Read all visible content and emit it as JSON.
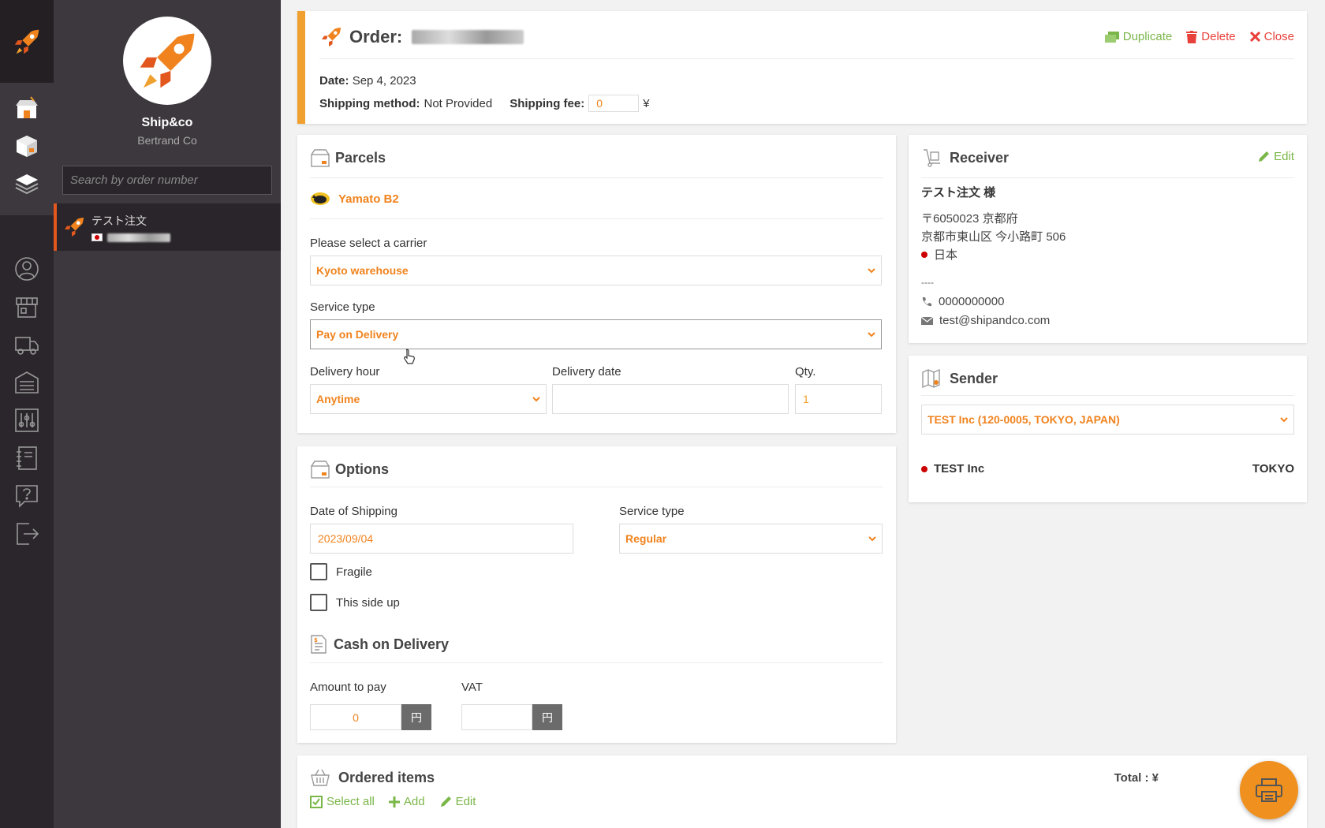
{
  "app": {
    "name": "Ship&co",
    "org": "Bertrand Co"
  },
  "sidebar": {
    "search_placeholder": "Search by order number",
    "order": {
      "name": "テスト注文"
    }
  },
  "order": {
    "title": "Order:",
    "actions": {
      "duplicate": "Duplicate",
      "delete": "Delete",
      "close": "Close"
    },
    "date_label": "Date:",
    "date_value": "Sep 4, 2023",
    "shipping_method_label": "Shipping method:",
    "shipping_method_value": "Not Provided",
    "shipping_fee_label": "Shipping fee:",
    "shipping_fee_value": "0",
    "currency_symbol": "¥"
  },
  "parcels": {
    "title": "Parcels",
    "carrier_name": "Yamato B2",
    "carrier_label": "Please select a carrier",
    "carrier_value": "Kyoto warehouse",
    "service_type_label": "Service type",
    "service_type_value": "Pay on Delivery",
    "delivery_hour_label": "Delivery hour",
    "delivery_hour_value": "Anytime",
    "delivery_date_label": "Delivery date",
    "delivery_date_value": "",
    "qty_label": "Qty.",
    "qty_value": "1"
  },
  "options": {
    "title": "Options",
    "date_of_shipping_label": "Date of Shipping",
    "date_of_shipping_value": "2023/09/04",
    "service_type_label": "Service type",
    "service_type_value": "Regular",
    "fragile_label": "Fragile",
    "this_side_up_label": "This side up",
    "cod_title": "Cash on Delivery",
    "amount_label": "Amount to pay",
    "amount_value": "0",
    "vat_label": "VAT",
    "vat_value": "",
    "yen_unit": "円"
  },
  "receiver": {
    "title": "Receiver",
    "edit": "Edit",
    "name": "テスト注文 様",
    "address_line1": "〒6050023 京都府",
    "address_line2": "京都市東山区 今小路町 506",
    "country": "日本",
    "separator": "----",
    "phone": "0000000000",
    "email": "test@shipandco.com"
  },
  "sender": {
    "title": "Sender",
    "select_value": "TEST Inc (120-0005, TOKYO, JAPAN)",
    "name": "TEST Inc",
    "city": "TOKYO"
  },
  "items": {
    "title": "Ordered items",
    "select_all": "Select all",
    "add": "Add",
    "edit": "Edit",
    "total_label": "Total : ¥"
  },
  "colors": {
    "accent": "#f0831e",
    "danger": "#e8403a",
    "success": "#7ab648",
    "sidebar": "#3d383d",
    "rail": "#2b262b"
  }
}
